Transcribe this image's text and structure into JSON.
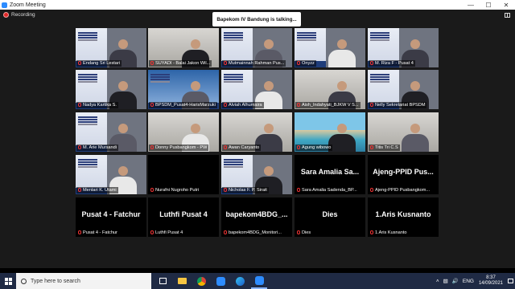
{
  "window": {
    "title": "Zoom Meeting",
    "minimize_icon": "minimize-icon",
    "maximize_icon": "maximize-icon",
    "close_icon": "close-icon"
  },
  "meeting": {
    "recording_label": "Recording",
    "speaker_banner": "Bapekom IV Bandung is talking...",
    "view_button_icon": "gallery-view-icon"
  },
  "participants": [
    {
      "name": "Endang Sri Lestari",
      "kind": "video",
      "style": "ppt"
    },
    {
      "name": "SUYADI - Balai Jakon Wil...",
      "kind": "video",
      "style": "room"
    },
    {
      "name": "Mutmainnah Rahman Pus...",
      "kind": "video",
      "style": "ppt"
    },
    {
      "name": "Onyzz",
      "kind": "video",
      "style": "ppt"
    },
    {
      "name": "M. Riza F - Pusat 4",
      "kind": "video",
      "style": "ppt"
    },
    {
      "name": "Nadya Kartika S.",
      "kind": "video",
      "style": "ppt"
    },
    {
      "name": "BPSDM_Pusat4-HarisMarzuki",
      "kind": "video",
      "style": "banner"
    },
    {
      "name": "Alviah Alhumaira",
      "kind": "video",
      "style": "ppt"
    },
    {
      "name": "Aish_Indahyati_BJKW V S...",
      "kind": "video",
      "style": "room"
    },
    {
      "name": "Nelly Sekretariat BPSDM",
      "kind": "video",
      "style": "ppt"
    },
    {
      "name": "M. Arie Mursandi",
      "kind": "video",
      "style": "ppt"
    },
    {
      "name": "Donny Pusbangkom - PW",
      "kind": "video",
      "style": "room"
    },
    {
      "name": "Awan Caryanto",
      "kind": "video",
      "style": "room"
    },
    {
      "name": "Agung wibowo",
      "kind": "video",
      "style": "beach"
    },
    {
      "name": "Titis Tri C.S",
      "kind": "video",
      "style": "room"
    },
    {
      "name": "Mentari K. Utami",
      "kind": "video",
      "style": "ppt"
    },
    {
      "name": "Nurafni Nugroho Putri",
      "kind": "blank",
      "style": "blank"
    },
    {
      "name": "Nicholas F. P. Sirait",
      "kind": "video",
      "style": "ppt"
    },
    {
      "name": "Sara Amalia Sadenda_BP...",
      "kind": "label",
      "big": "Sara Amalia Sa..."
    },
    {
      "name": "Ajeng-PPID Pusbangkom...",
      "kind": "label",
      "big": "Ajeng-PPID Pus..."
    },
    {
      "name": "Pusat 4 - Fatchur",
      "kind": "label",
      "big": "Pusat 4 - Fatchur"
    },
    {
      "name": "Luthfi Pusat 4",
      "kind": "label",
      "big": "Luthfi Pusat 4"
    },
    {
      "name": "bapekom4BDG_Monitori...",
      "kind": "label",
      "big": "bapekom4BDG_..."
    },
    {
      "name": "Dies",
      "kind": "label",
      "big": "Dies"
    },
    {
      "name": "1.Aris Kusnanto",
      "kind": "label",
      "big": "1.Aris Kusnanto"
    }
  ],
  "taskbar": {
    "search_placeholder": "Type here to search",
    "start_icon": "windows-start-icon",
    "apps": [
      "task-view-icon",
      "file-explorer-icon",
      "chrome-icon",
      "zoom-icon",
      "edge-icon",
      "zoom-app-icon"
    ],
    "tray": {
      "language": "ENG",
      "time": "8:37",
      "date": "14/09/2021"
    }
  },
  "colors": {
    "zoom_blue": "#2d8cff",
    "recording_red": "#e02828",
    "taskbar": "#1f2a44"
  }
}
